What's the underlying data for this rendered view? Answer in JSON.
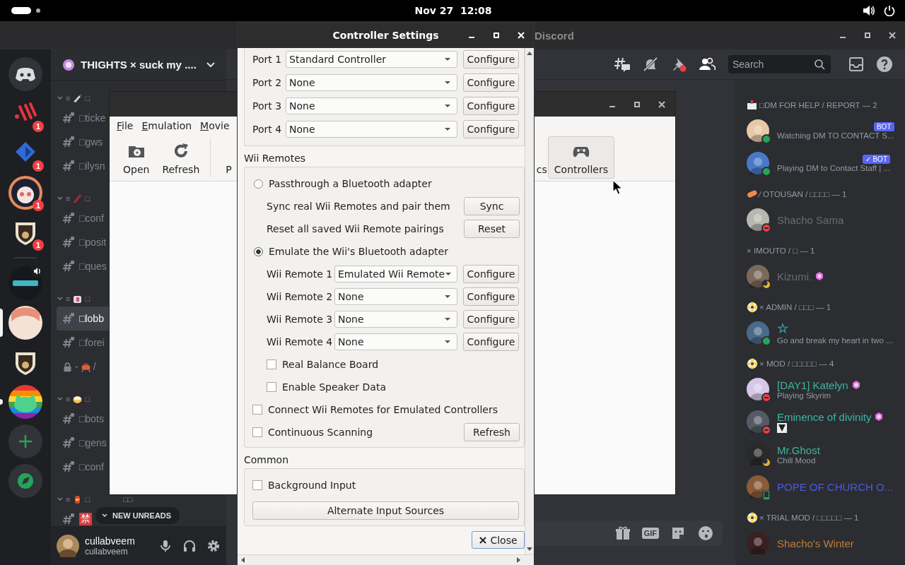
{
  "top_bar": {
    "clock": "Nov 27  12:08"
  },
  "discord": {
    "title": "Discord",
    "server_name": "THIGHTS × suck my ....",
    "servers": [
      {
        "kind": "home",
        "selected": false,
        "unread": false
      },
      {
        "kind": "mark",
        "selected": false,
        "unread": false,
        "badge": "1"
      },
      {
        "kind": "diamond",
        "selected": false,
        "unread": false,
        "badge": "1"
      },
      {
        "kind": "robot",
        "selected": false,
        "unread": false,
        "badge": "1"
      },
      {
        "kind": "crest",
        "selected": false,
        "unread": false,
        "badge": "1"
      },
      {
        "kind": "divider"
      },
      {
        "kind": "voice",
        "selected": false,
        "unread": false
      },
      {
        "kind": "anime",
        "selected": true,
        "unread": false
      },
      {
        "kind": "crest",
        "selected": false,
        "unread": false
      },
      {
        "kind": "rainbow",
        "selected": false,
        "unread": true
      },
      {
        "kind": "add"
      },
      {
        "kind": "explore"
      }
    ],
    "categories": [
      {
        "kind": "knife",
        "prefix": "≡",
        "label": "□",
        "channels": [
          {
            "kind": "text",
            "name": "□ticke",
            "selected": false
          },
          {
            "kind": "text",
            "name": "□gws",
            "selected": false
          },
          {
            "kind": "text",
            "name": "□ilysn",
            "selected": false
          }
        ]
      },
      {
        "kind": "slash",
        "prefix": "≡",
        "label": "□",
        "channels": [
          {
            "kind": "text",
            "name": "□conf",
            "selected": false
          },
          {
            "kind": "text",
            "name": "□posit",
            "selected": false
          },
          {
            "kind": "text",
            "name": "□ques",
            "selected": false
          }
        ]
      },
      {
        "kind": "cube",
        "prefix": "≡",
        "label": "□",
        "channels": [
          {
            "kind": "text",
            "name": "□lobb",
            "selected": true
          },
          {
            "kind": "text",
            "name": "□forei",
            "selected": false
          },
          {
            "kind": "locked",
            "name": "-",
            "suffix": "/",
            "selected": false
          }
        ]
      },
      {
        "kind": "bowl",
        "prefix": "≡",
        "label": "□",
        "channels": [
          {
            "kind": "text",
            "name": "□bots",
            "selected": false
          },
          {
            "kind": "text",
            "name": "□gens",
            "selected": false
          },
          {
            "kind": "text",
            "name": "□conf",
            "selected": false
          }
        ]
      },
      {
        "kind": "lantern",
        "prefix": "≡",
        "label": "□",
        "tail": "□□",
        "channels": [
          {
            "kind": "boxed",
            "name": "禁",
            "selected": false
          }
        ]
      }
    ],
    "new_unreads": "NEW UNREADS",
    "user": {
      "name": "cullabveem",
      "tag": "cullabveem"
    },
    "search": {
      "placeholder": "Search"
    },
    "composer": {
      "gif": "GIF"
    },
    "member_groups": [
      {
        "kind": "mailbox",
        "title": "□DM FOR HELP / REPORT — 2",
        "members": [
          {
            "kind": "online",
            "badge": "BOT",
            "activity": "Watching DM TO CONTACT S..."
          },
          {
            "kind": "online",
            "badge": "✓ BOT",
            "activity": "Playing DM to Contact Staff | ..."
          }
        ]
      },
      {
        "kind": "pill",
        "title": "⁄ OTOUSAN / □□□□ — 1",
        "members": [
          {
            "kind": "dnd",
            "name": "Shacho Sama",
            "color": "#6a6d74"
          }
        ]
      },
      {
        "kind": "plain",
        "title": "× IMOUTO / □ — 1",
        "members": [
          {
            "kind": "idle",
            "name": "Kizumi.",
            "color": "#6a6d74",
            "boost": true
          }
        ]
      },
      {
        "kind": "flower",
        "title": "× ADMIN / □□□ — 1",
        "members": [
          {
            "kind": "online",
            "name": "☆",
            "color": "#3aa3a3",
            "activity": "Go and break my heart in two ..."
          }
        ]
      },
      {
        "kind": "flower",
        "title": "× MOD / □□□□□ — 4",
        "members": [
          {
            "kind": "dnd",
            "name": "[DAY1] Katelyn",
            "color": "#3fb5a0",
            "boost": true,
            "activity": "Playing Skyrim"
          },
          {
            "kind": "dnd",
            "name": "Eminence of divinity",
            "color": "#3fb5a0",
            "boost": true,
            "sticker": true
          },
          {
            "kind": "idle",
            "name": "Mr.Ghost",
            "color": "#3fb5a0",
            "activity": "Chill Mood"
          },
          {
            "kind": "mobile",
            "name": "POPE OF CHURCH O...",
            "color": "#4a5ae0"
          }
        ]
      },
      {
        "kind": "flower",
        "title": "× TRIAL MOD / □□□□□ — 1",
        "members": [
          {
            "kind": "plain",
            "name": "Shacho's Winter",
            "color": "#c27c3a"
          }
        ]
      }
    ]
  },
  "dolphin": {
    "menu": [
      "File",
      "Emulation",
      "Movie"
    ],
    "toolbar": [
      {
        "kind": "open",
        "label": "Open",
        "hover": false
      },
      {
        "kind": "refresh",
        "label": "Refresh",
        "hover": false
      },
      {
        "kind": "plain",
        "label": "P",
        "hover": false
      },
      {
        "kind": "plain",
        "label": "cs",
        "hover": false
      },
      {
        "kind": "gamepad",
        "label": "Controllers",
        "hover": true
      }
    ]
  },
  "controller_settings": {
    "title": "Controller Settings",
    "gamecube_ports": [
      {
        "label": "Port 1",
        "value": "Standard Controller",
        "button": "Configure"
      },
      {
        "label": "Port 2",
        "value": "None",
        "button": "Configure"
      },
      {
        "label": "Port 3",
        "value": "None",
        "button": "Configure"
      },
      {
        "label": "Port 4",
        "value": "None",
        "button": "Configure"
      }
    ],
    "wii": {
      "title": "Wii Remotes",
      "passthrough": {
        "label": "Passthrough a Bluetooth adapter",
        "selected": false
      },
      "passthrough_actions": [
        {
          "label": "Sync real Wii Remotes and pair them",
          "button": "Sync"
        },
        {
          "label": "Reset all saved Wii Remote pairings",
          "button": "Reset"
        }
      ],
      "emulate": {
        "label": "Emulate the Wii's Bluetooth adapter",
        "selected": true
      },
      "remotes": [
        {
          "label": "Wii Remote 1",
          "value": "Emulated Wii Remote",
          "button": "Configure"
        },
        {
          "label": "Wii Remote 2",
          "value": "None",
          "button": "Configure"
        },
        {
          "label": "Wii Remote 3",
          "value": "None",
          "button": "Configure"
        },
        {
          "label": "Wii Remote 4",
          "value": "None",
          "button": "Configure"
        }
      ],
      "remote_options": [
        {
          "label": "Real Balance Board",
          "checked": false
        },
        {
          "label": "Enable Speaker Data",
          "checked": false
        }
      ],
      "options": [
        {
          "label": "Connect Wii Remotes for Emulated Controllers",
          "checked": false
        },
        {
          "label": "Continuous Scanning",
          "checked": false,
          "button": "Refresh"
        }
      ]
    },
    "common": {
      "title": "Common",
      "options": [
        {
          "label": "Background Input",
          "checked": false
        }
      ],
      "button": "Alternate Input Sources"
    },
    "close": "Close"
  }
}
